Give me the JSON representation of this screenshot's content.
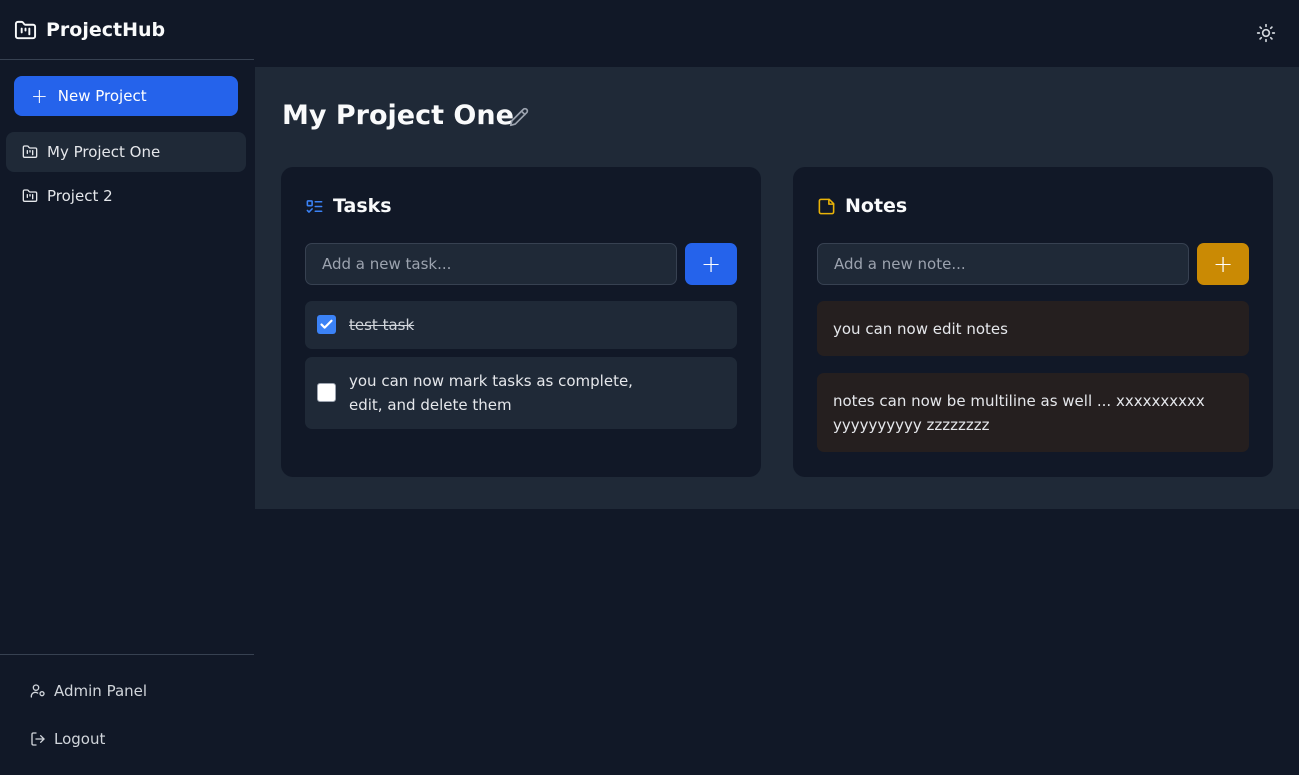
{
  "app": {
    "name": "ProjectHub"
  },
  "sidebar": {
    "new_project_label": "New Project",
    "projects": [
      {
        "label": "My Project One",
        "active": true
      },
      {
        "label": "Project 2",
        "active": false
      }
    ],
    "footer": {
      "admin_label": "Admin Panel",
      "logout_label": "Logout"
    }
  },
  "main": {
    "title": "My Project One",
    "tasks": {
      "heading": "Tasks",
      "input_placeholder": "Add a new task...",
      "items": [
        {
          "text": "test task",
          "completed": true
        },
        {
          "text": "you can now mark tasks as complete, edit, and delete them",
          "completed": false
        }
      ]
    },
    "notes": {
      "heading": "Notes",
      "input_placeholder": "Add a new note...",
      "items": [
        {
          "text": "you can now edit notes"
        },
        {
          "text": "notes can now be multiline as well ... xxxxxxxxxx yyyyyyyyyy zzzzzzzz"
        }
      ]
    }
  },
  "colors": {
    "accent_blue": "#2563eb",
    "accent_amber": "#ca8a04",
    "background": "#111827",
    "panel": "#1f2937"
  },
  "icons": {
    "brand": "folder-kanban-icon",
    "theme": "sun-icon",
    "tasks": "list-checks-icon",
    "notes": "sticky-note-icon",
    "edit": "pencil-icon",
    "admin": "user-cog-icon",
    "logout": "log-out-icon"
  }
}
